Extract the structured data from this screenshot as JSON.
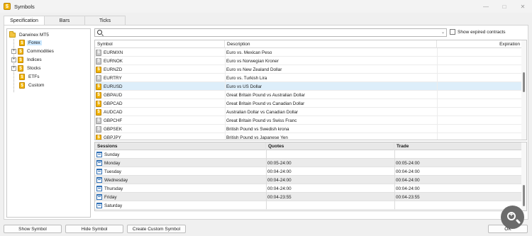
{
  "window": {
    "title": "Symbols",
    "app_icon": "dollar-coin-icon"
  },
  "tabs": [
    {
      "label": "Specification",
      "active": true
    },
    {
      "label": "Bars",
      "active": false
    },
    {
      "label": "Ticks",
      "active": false
    }
  ],
  "tree": {
    "root": "Darwinex MT5",
    "items": [
      {
        "label": "Forex",
        "selected": true
      },
      {
        "label": "Commodities"
      },
      {
        "label": "Indices"
      },
      {
        "label": "Stocks"
      },
      {
        "label": "ETFs"
      },
      {
        "label": "Custom"
      }
    ]
  },
  "search": {
    "value": "",
    "placeholder": ""
  },
  "show_expired_label": "Show expired contracts",
  "symbols_table": {
    "headers": {
      "symbol": "Symbol",
      "description": "Description",
      "expiration": "Expiration"
    },
    "rows": [
      {
        "symbol": "EURMXN",
        "description": "Euro vs. Mexican Peso",
        "active": false
      },
      {
        "symbol": "EURNOK",
        "description": "Euro vs Norwegian Kroner",
        "active": false
      },
      {
        "symbol": "EURNZD",
        "description": "Euro vs New Zealand Dollar",
        "active": true
      },
      {
        "symbol": "EURTRY",
        "description": "Euro vs. Turkish Lira",
        "active": false
      },
      {
        "symbol": "EURUSD",
        "description": "Euro vs US Dollar",
        "active": true,
        "selected": true
      },
      {
        "symbol": "GBPAUD",
        "description": "Great Britain Pound vs Australian Dollar",
        "active": true
      },
      {
        "symbol": "GBPCAD",
        "description": "Great Britain Pound vs Canadian Dollar",
        "active": true
      },
      {
        "symbol": "AUDCAD",
        "description": "Australian Dollar vs Canadian Dollar",
        "active": true
      },
      {
        "symbol": "GBPCHF",
        "description": "Great Britain Pound vs Swiss Franc",
        "active": false
      },
      {
        "symbol": "GBPSEK",
        "description": "British Pound vs Swedish krona",
        "active": false
      },
      {
        "symbol": "GBPJPY",
        "description": "British Pound vs Japanese Yen",
        "active": true
      }
    ]
  },
  "sessions_table": {
    "headers": {
      "sessions": "Sessions",
      "quotes": "Quotes",
      "trade": "Trade"
    },
    "rows": [
      {
        "day": "Sunday",
        "quotes": "",
        "trade": ""
      },
      {
        "day": "Monday",
        "quotes": "00:05-24:00",
        "trade": "00:05-24:00"
      },
      {
        "day": "Tuesday",
        "quotes": "00:04-24:00",
        "trade": "00:04-24:00"
      },
      {
        "day": "Wednesday",
        "quotes": "00:04-24:00",
        "trade": "00:04-24:00"
      },
      {
        "day": "Thursday",
        "quotes": "00:04-24:00",
        "trade": "00:04-24:00"
      },
      {
        "day": "Friday",
        "quotes": "00:04-23:55",
        "trade": "00:04-23:55"
      },
      {
        "day": "Saturday",
        "quotes": "",
        "trade": ""
      }
    ]
  },
  "buttons": {
    "show_symbol": "Show Symbol",
    "hide_symbol": "Hide Symbol",
    "create_custom_symbol": "Create Custom Symbol",
    "ok": "OK"
  },
  "colors": {
    "selection": "#cce8ff",
    "coin_active": "#f2b400",
    "coin_inactive": "#c9c9c9",
    "calendar": "#2f6fb5"
  }
}
